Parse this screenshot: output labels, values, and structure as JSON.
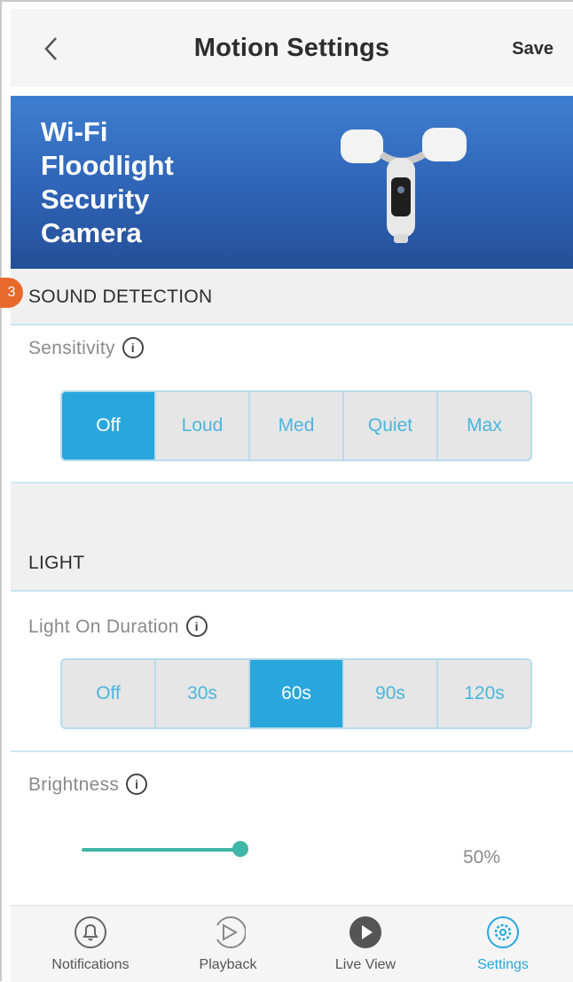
{
  "header": {
    "title": "Motion Settings",
    "save_label": "Save"
  },
  "banner": {
    "product_name": "Wi-Fi\nFloodlight\nSecurity\nCamera"
  },
  "callout_badge": "3",
  "sound_detection": {
    "section_title": "SOUND DETECTION",
    "sensitivity_label": "Sensitivity",
    "options": [
      "Off",
      "Loud",
      "Med",
      "Quiet",
      "Max"
    ],
    "selected": "Off"
  },
  "light": {
    "section_title": "LIGHT",
    "duration_label": "Light On Duration",
    "duration_options": [
      "Off",
      "30s",
      "60s",
      "90s",
      "120s"
    ],
    "duration_selected": "60s",
    "brightness_label": "Brightness",
    "brightness_value": "50%",
    "brightness_fraction": 0.5
  },
  "info_glyph": "i",
  "tabs": [
    {
      "label": "Notifications",
      "icon": "bell-icon"
    },
    {
      "label": "Playback",
      "icon": "playback-icon"
    },
    {
      "label": "Live View",
      "icon": "live-view-play-icon"
    },
    {
      "label": "Settings",
      "icon": "gear-icon"
    }
  ],
  "colors": {
    "accent": "#29a7dd",
    "slider": "#3fb6a6",
    "banner": "#2f63b5",
    "badge": "#e8692c"
  }
}
